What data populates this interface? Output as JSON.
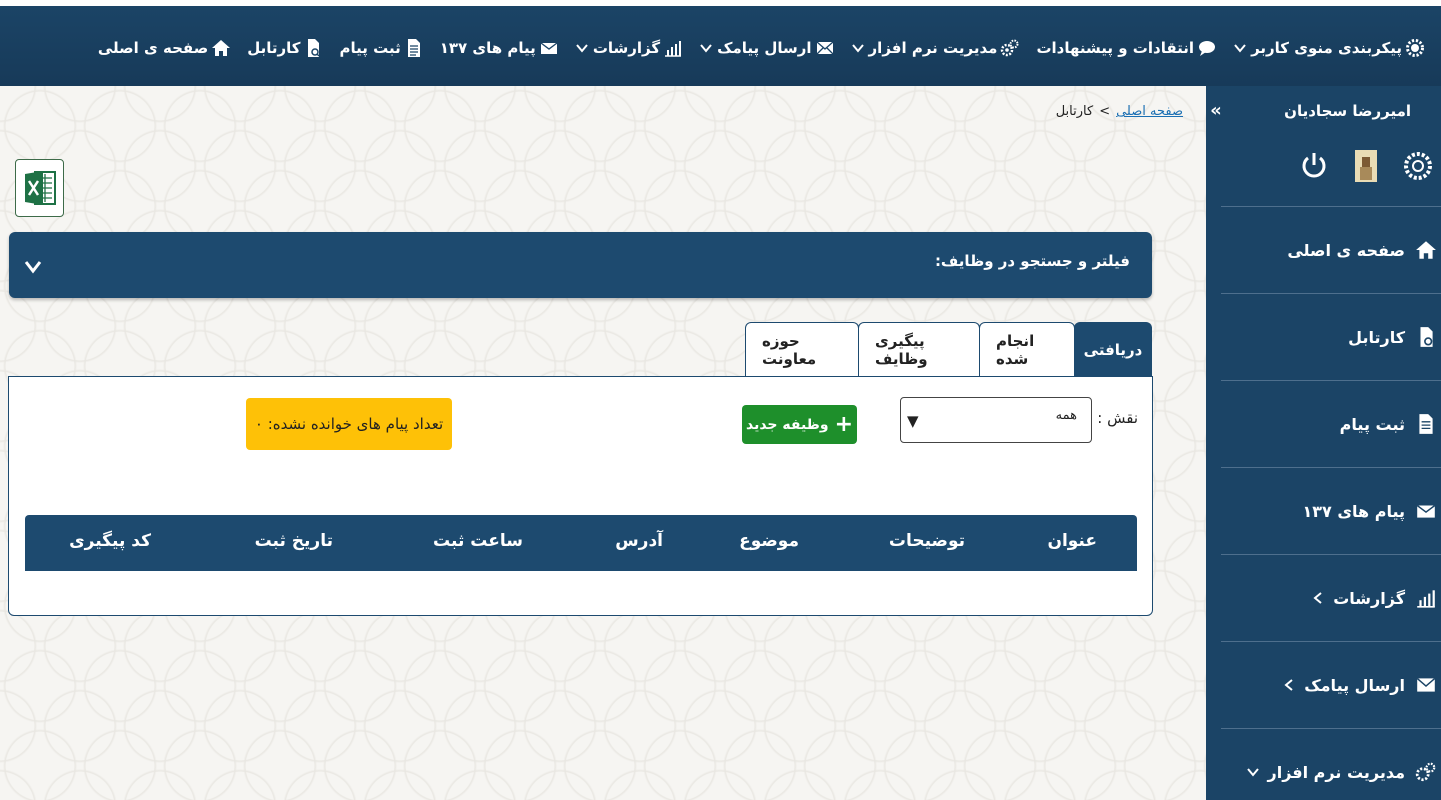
{
  "topnav": {
    "items": [
      {
        "label": "صفحه ی اصلی",
        "icon": "home-icon",
        "dropdown": false
      },
      {
        "label": "کارتابل",
        "icon": "inbox-doc-icon",
        "dropdown": false
      },
      {
        "label": "ثبت پیام",
        "icon": "doc-icon",
        "dropdown": false
      },
      {
        "label": "پیام های ۱۳۷",
        "icon": "mail-137-icon",
        "dropdown": false
      },
      {
        "label": "گزارشات",
        "icon": "chart-icon",
        "dropdown": true
      },
      {
        "label": "ارسال پیامک",
        "icon": "envelope-icon",
        "dropdown": true
      },
      {
        "label": "مدیریت نرم افزار",
        "icon": "gears-icon",
        "dropdown": true
      },
      {
        "label": "انتقادات و پیشنهادات",
        "icon": "chat-icon",
        "dropdown": false
      },
      {
        "label": "پیکربندی منوی کاربر",
        "icon": "gear-user-icon",
        "dropdown": true
      }
    ]
  },
  "sidebar": {
    "user_name": "امیررضا سجادیان",
    "collapse_glyph": "«",
    "items": [
      {
        "label": "صفحه ی اصلی",
        "icon": "home-icon",
        "dropdown": false
      },
      {
        "label": "کارتابل",
        "icon": "inbox-doc-icon",
        "dropdown": false
      },
      {
        "label": "ثبت پیام",
        "icon": "doc-icon",
        "dropdown": false
      },
      {
        "label": "پیام های ۱۳۷",
        "icon": "mail-137-icon",
        "dropdown": false
      },
      {
        "label": "گزارشات",
        "icon": "chart-icon",
        "dropdown": "left"
      },
      {
        "label": "ارسال پیامک",
        "icon": "envelope-icon",
        "dropdown": "left"
      },
      {
        "label": "مدیریت نرم افزار",
        "icon": "gears-icon",
        "dropdown": "down"
      }
    ]
  },
  "breadcrumb": {
    "home": "صفحه اصلی",
    "separator": ">",
    "current": "کارتابل"
  },
  "filter": {
    "title": "فیلتر و جستجو در وظایف:"
  },
  "tabs": [
    {
      "label": "دریافتی",
      "active": true
    },
    {
      "label": "انجام شده",
      "active": false
    },
    {
      "label": "پیگیری وظایف",
      "active": false
    },
    {
      "label": "حوزه معاونت",
      "active": false
    }
  ],
  "panel": {
    "role_label": "نقش :",
    "role_value": "همه",
    "role_arrow": "▼",
    "new_task_label": "وظیفه جدید",
    "new_task_plus": "+",
    "unread_text": "تعداد پیام های خوانده نشده: ۰"
  },
  "table": {
    "headers": [
      "عنوان",
      "توضیحات",
      "موضوع",
      "آدرس",
      "ساعت ثبت",
      "تاریخ ثبت",
      "کد پیگیری"
    ]
  },
  "colors": {
    "primary": "#1d4a6f",
    "success": "#1e8f2b",
    "warning": "#fec107",
    "link": "#1a6fb3"
  }
}
